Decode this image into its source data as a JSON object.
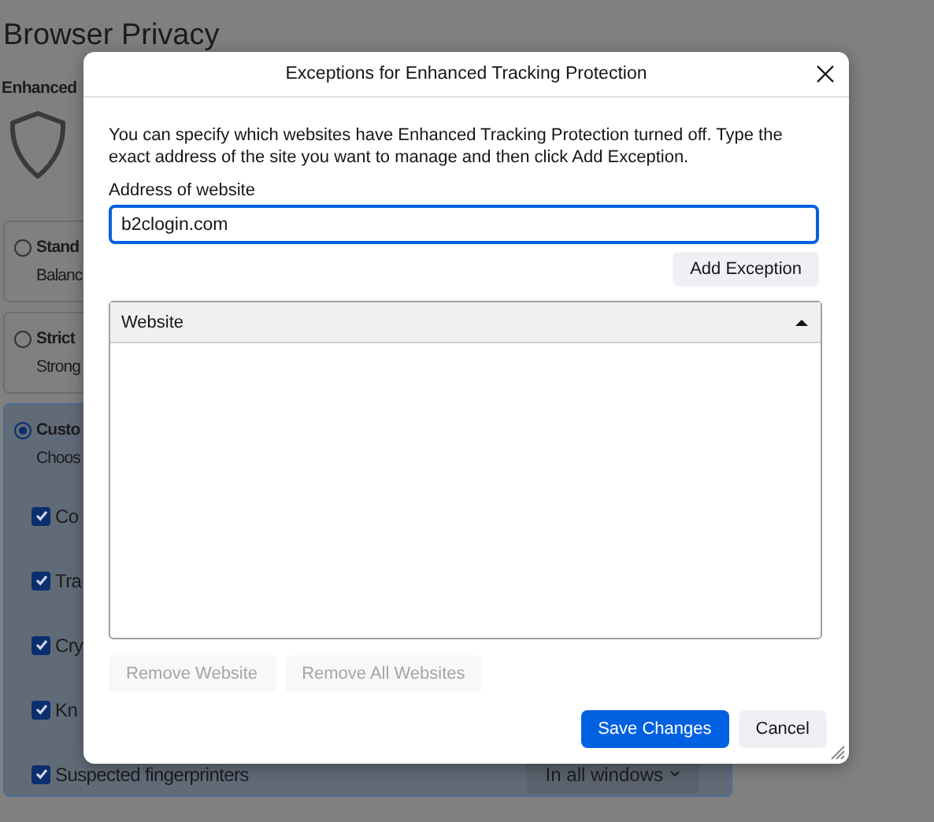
{
  "background": {
    "heading": "Browser Privacy",
    "section_label": "Enhanced",
    "cards": [
      {
        "title": "Stand",
        "description": "Balanc",
        "selected": false
      },
      {
        "title": "Strict",
        "description": "Strong",
        "selected": false
      },
      {
        "title": "Custo",
        "description": "Choos",
        "selected": true
      }
    ],
    "checkboxes": [
      {
        "label": "Co",
        "checked": true
      },
      {
        "label": "Tra",
        "checked": true
      },
      {
        "label": "Cry",
        "checked": true
      },
      {
        "label": "Kn",
        "checked": true
      },
      {
        "label": "Suspected fingerprinters",
        "checked": true
      }
    ],
    "dropdown": {
      "value": "In all windows"
    }
  },
  "dialog": {
    "title": "Exceptions for Enhanced Tracking Protection",
    "description": "You can specify which websites have Enhanced Tracking Protection turned off. Type the exact address of the site you want to manage and then click Add Exception.",
    "address_label": "Address of website",
    "address_value": "b2clogin.com",
    "add_button": "Add Exception",
    "table": {
      "columns": [
        {
          "label": "Website",
          "sort_ascending": true
        }
      ]
    },
    "list_buttons": [
      {
        "label": "Remove Website",
        "disabled": true
      },
      {
        "label": "Remove All Websites",
        "disabled": true
      }
    ],
    "buttons": [
      {
        "label": "Save Changes",
        "kind": "primary"
      },
      {
        "label": "Cancel",
        "kind": "secondary"
      }
    ]
  }
}
